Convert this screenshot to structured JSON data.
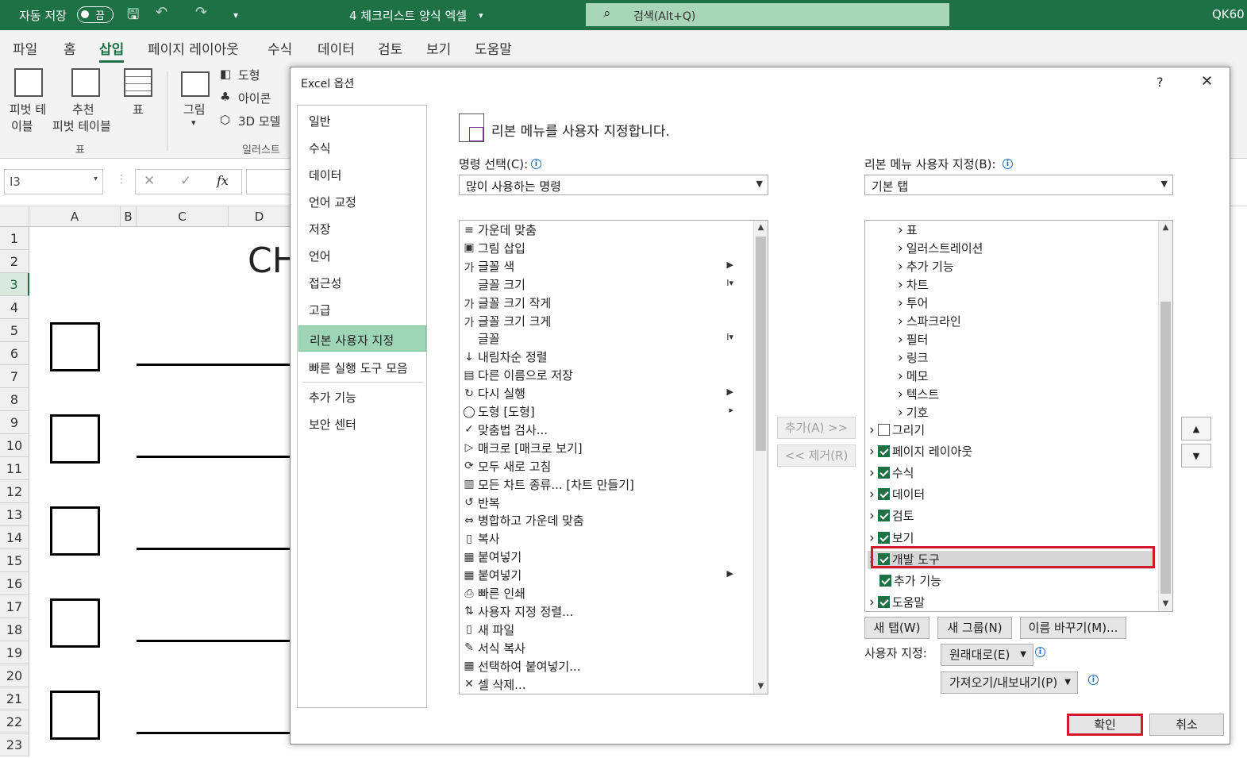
{
  "titlebar": {
    "autosave_label": "자동 저장",
    "autosave_state": "끔",
    "filename": "4 체크리스트 양식 엑셀",
    "search_placeholder": "검색(Alt+Q)",
    "user": "QK60"
  },
  "menu": [
    "파일",
    "홈",
    "삽입",
    "페이지 레이아웃",
    "수식",
    "데이터",
    "검토",
    "보기",
    "도움말"
  ],
  "menu_active": "삽입",
  "ribbon": {
    "pivot_line1": "피벗 테",
    "pivot_line2": "이블",
    "recommended_line1": "추천",
    "recommended_line2": "피벗 테이블",
    "table": "표",
    "picture": "그림",
    "shapes": "도형",
    "icons": "아이콘",
    "models3d": "3D 모델",
    "group_table": "표",
    "group_illustrations": "일러스트"
  },
  "formula_bar": {
    "namebox": "I3",
    "fx": "fx"
  },
  "sheet": {
    "columns": [
      "A",
      "B",
      "C",
      "D"
    ],
    "rows": [
      "1",
      "2",
      "3",
      "4",
      "5",
      "6",
      "7",
      "8",
      "9",
      "10",
      "11",
      "12",
      "13",
      "14",
      "15",
      "16",
      "17",
      "18",
      "19",
      "20",
      "21",
      "22",
      "23"
    ],
    "title_fragment": "CH"
  },
  "dialog": {
    "title": "Excel 옵션",
    "help": "?",
    "close": "✕",
    "nav": [
      "일반",
      "수식",
      "데이터",
      "언어 교정",
      "저장",
      "언어",
      "접근성",
      "고급",
      "리본 사용자 지정",
      "빠른 실행 도구 모음",
      "추가 기능",
      "보안 센터"
    ],
    "nav_selected": "리본 사용자 지정",
    "heading": "리본 메뉴를 사용자 지정합니다.",
    "choose_label": "명령 선택(C):",
    "choose_value": "많이 사용하는 명령",
    "customize_label": "리본 메뉴 사용자 지정(B):",
    "customize_value": "기본 탭",
    "commands": [
      {
        "icon": "≡",
        "label": "가운데 맞춤",
        "arrow": ""
      },
      {
        "icon": "▣",
        "label": "그림 삽입",
        "arrow": ""
      },
      {
        "icon": "가",
        "label": "글꼴 색",
        "arrow": "▶"
      },
      {
        "icon": "",
        "label": "글꼴 크기",
        "arrow": "I▾"
      },
      {
        "icon": "가",
        "label": "글꼴 크기 작게",
        "arrow": ""
      },
      {
        "icon": "가",
        "label": "글꼴 크기 크게",
        "arrow": ""
      },
      {
        "icon": "",
        "label": "글꼴",
        "arrow": "I▾"
      },
      {
        "icon": "↓",
        "label": "내림차순 정렬",
        "arrow": ""
      },
      {
        "icon": "▤",
        "label": "다른 이름으로 저장",
        "arrow": ""
      },
      {
        "icon": "↻",
        "label": "다시 실행",
        "arrow": "▶"
      },
      {
        "icon": "◯",
        "label": "도형 [도형]",
        "arrow": "▸"
      },
      {
        "icon": "✓",
        "label": "맞춤법 검사...",
        "arrow": ""
      },
      {
        "icon": "▷",
        "label": "매크로 [매크로 보기]",
        "arrow": ""
      },
      {
        "icon": "⟳",
        "label": "모두 새로 고침",
        "arrow": ""
      },
      {
        "icon": "▥",
        "label": "모든 차트 종류... [차트 만들기]",
        "arrow": ""
      },
      {
        "icon": "↺",
        "label": "반복",
        "arrow": ""
      },
      {
        "icon": "⇔",
        "label": "병합하고 가운데 맞춤",
        "arrow": ""
      },
      {
        "icon": "▯",
        "label": "복사",
        "arrow": ""
      },
      {
        "icon": "▦",
        "label": "붙여넣기",
        "arrow": ""
      },
      {
        "icon": "▦",
        "label": "붙여넣기",
        "arrow": "▶"
      },
      {
        "icon": "⎙",
        "label": "빠른 인쇄",
        "arrow": ""
      },
      {
        "icon": "⇅",
        "label": "사용자 지정 정렬...",
        "arrow": ""
      },
      {
        "icon": "▯",
        "label": "새 파일",
        "arrow": ""
      },
      {
        "icon": "✎",
        "label": "서식 복사",
        "arrow": ""
      },
      {
        "icon": "▦",
        "label": "선택하여 붙여넣기...",
        "arrow": ""
      },
      {
        "icon": "✕",
        "label": "셀 삭제...",
        "arrow": ""
      }
    ],
    "add_button": "추가(A) >>",
    "remove_button": "<< 제거(R)",
    "tabs_tree": [
      {
        "indent": 2,
        "check": "",
        "label": "표"
      },
      {
        "indent": 2,
        "check": "",
        "label": "일러스트레이션"
      },
      {
        "indent": 2,
        "check": "",
        "label": "추가 기능"
      },
      {
        "indent": 2,
        "check": "",
        "label": "차트"
      },
      {
        "indent": 2,
        "check": "",
        "label": "투어"
      },
      {
        "indent": 2,
        "check": "",
        "label": "스파크라인"
      },
      {
        "indent": 2,
        "check": "",
        "label": "필터"
      },
      {
        "indent": 2,
        "check": "",
        "label": "링크"
      },
      {
        "indent": 2,
        "check": "",
        "label": "메모"
      },
      {
        "indent": 2,
        "check": "",
        "label": "텍스트"
      },
      {
        "indent": 2,
        "check": "",
        "label": "기호"
      },
      {
        "indent": 1,
        "check": "off",
        "label": "그리기"
      },
      {
        "indent": 1,
        "check": "on",
        "label": "페이지 레이아웃"
      },
      {
        "indent": 1,
        "check": "on",
        "label": "수식"
      },
      {
        "indent": 1,
        "check": "on",
        "label": "데이터"
      },
      {
        "indent": 1,
        "check": "on",
        "label": "검토"
      },
      {
        "indent": 1,
        "check": "on",
        "label": "보기"
      },
      {
        "indent": 1,
        "check": "on",
        "label": "개발 도구"
      },
      {
        "indent": 0,
        "check": "on",
        "label": "추가 기능"
      },
      {
        "indent": 1,
        "check": "on",
        "label": "도움말"
      }
    ],
    "new_tab": "새 탭(W)",
    "new_group": "새 그룹(N)",
    "rename": "이름 바꾸기(M)...",
    "customize_section_label": "사용자 지정:",
    "reset": "원래대로(E)",
    "import_export": "가져오기/내보내기(P)",
    "ok": "확인",
    "cancel": "취소"
  },
  "colors": {
    "excel_green": "#1e7145",
    "selection": "#9fd5b7",
    "highlight": "#d4172a"
  }
}
